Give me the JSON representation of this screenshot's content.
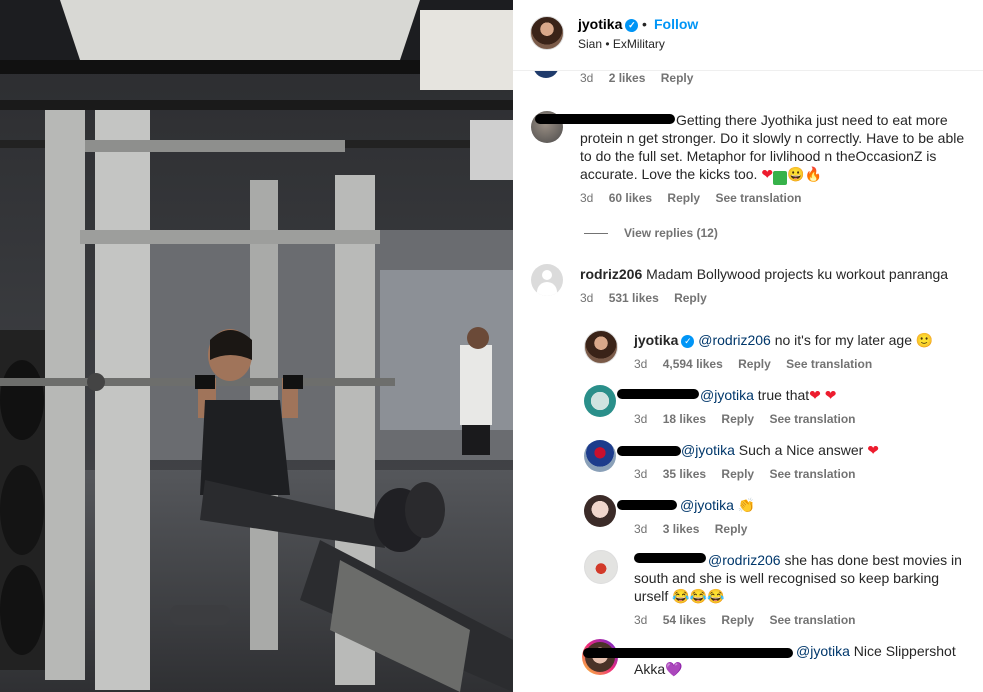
{
  "header": {
    "username": "jyotika",
    "verified_mark": "✓",
    "dot": "•",
    "follow_label": "Follow",
    "subtitle": "Sian • ExMilitary",
    "more_icon": "⋮"
  },
  "top_meta": {
    "time": "3d",
    "likes": "2 likes",
    "reply": "Reply"
  },
  "comments": [
    {
      "text": "Getting there Jyothika just need to eat more protein n get stronger. Do it slowly n correctly. Have to be able to do the full set. Metaphor for livlihood n theOccasionZ is accurate. Love the kicks too.",
      "time": "3d",
      "likes": "60 likes",
      "reply": "Reply",
      "translate": "See translation",
      "view_replies": "View replies (12)"
    },
    {
      "username": "rodriz206",
      "text": "Madam Bollywood projects ku workout panranga",
      "time": "3d",
      "likes": "531 likes",
      "reply": "Reply"
    }
  ],
  "replies": [
    {
      "username": "jyotika",
      "mention": "@rodriz206",
      "text": "no it's for my later age",
      "emoji": "🙂",
      "time": "3d",
      "likes": "4,594 likes",
      "reply": "Reply",
      "translate": "See translation"
    },
    {
      "mention": "@jyotika",
      "text": "true that",
      "emoji": "❤ ❤",
      "time": "3d",
      "likes": "18 likes",
      "reply": "Reply",
      "translate": "See translation"
    },
    {
      "mention": "@jyotika",
      "text": "Such a Nice answer",
      "emoji": "❤",
      "time": "3d",
      "likes": "35 likes",
      "reply": "Reply",
      "translate": "See translation"
    },
    {
      "mention": "@jyotika",
      "text": "",
      "emoji": "👏",
      "time": "3d",
      "likes": "3 likes",
      "reply": "Reply"
    },
    {
      "mention": "@rodriz206",
      "text": "she has done best movies in south and she is well recognised so keep barking urself",
      "emoji": "😂😂😂",
      "time": "3d",
      "likes": "54 likes",
      "reply": "Reply",
      "translate": "See translation"
    },
    {
      "mention": "@jyotika",
      "text": "Nice Slippershot Akka",
      "emoji": "💜"
    }
  ],
  "emoji_row_1": {
    "heart": "❤",
    "check": "✓",
    "face": "😀",
    "fire": "🔥"
  },
  "colors": {
    "accent": "#0095f6",
    "mention": "#00376b",
    "meta": "#737373"
  }
}
